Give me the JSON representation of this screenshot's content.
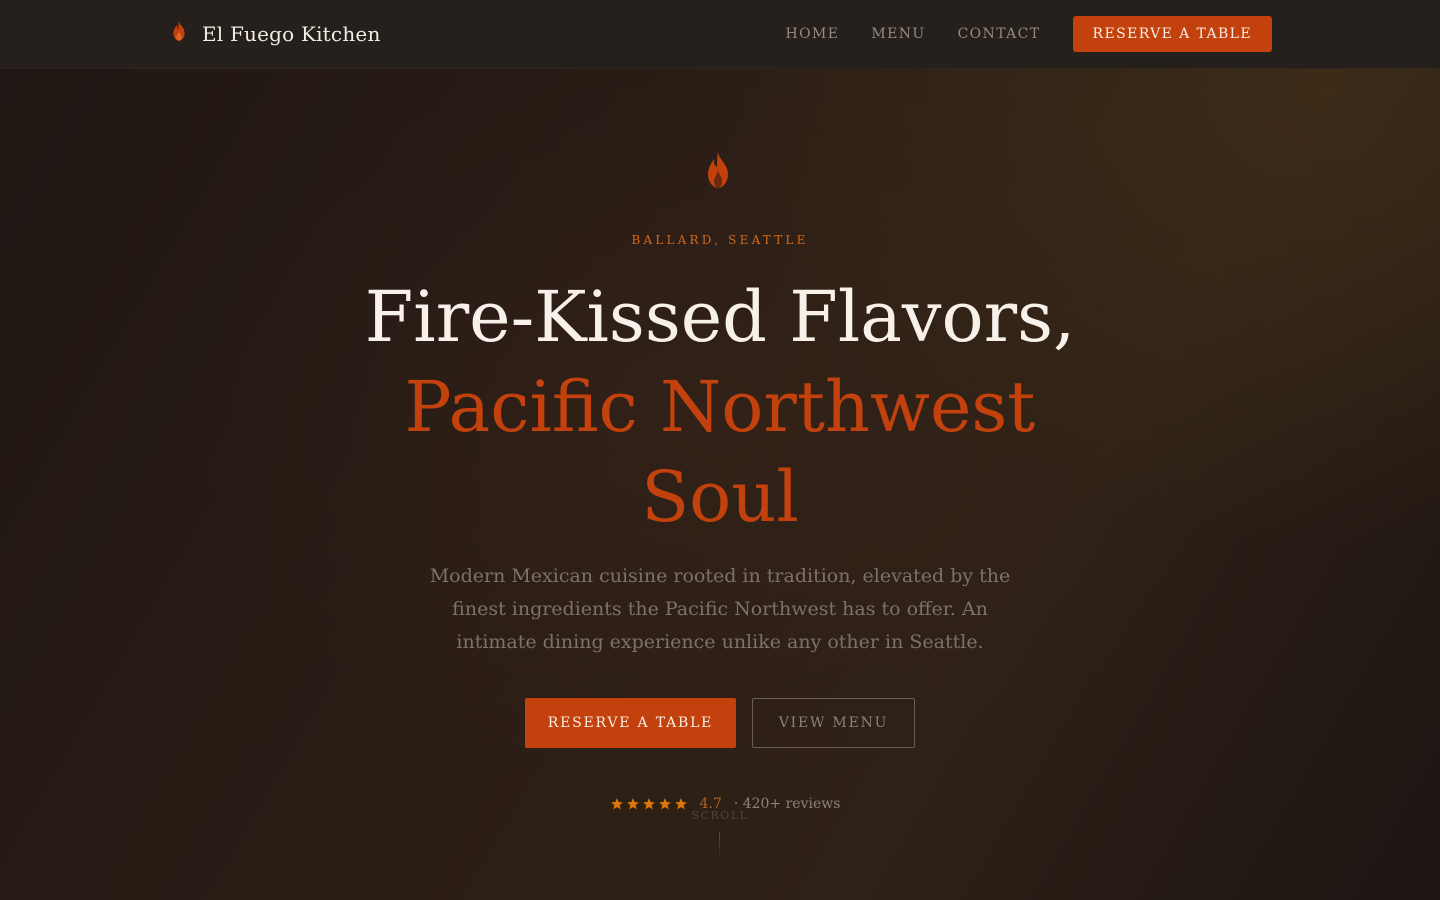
{
  "brand": {
    "name": "El Fuego Kitchen",
    "icon": "flame-icon"
  },
  "nav": {
    "links": [
      "HOME",
      "MENU",
      "CONTACT"
    ],
    "cta_label": "RESERVE A TABLE"
  },
  "hero": {
    "icon": "flame-icon",
    "location": "BALLARD, SEATTLE",
    "headline_line1": "Fire-Kissed Flavors,",
    "headline_line2": "Pacific Northwest",
    "headline_line3": "Soul",
    "tagline": "Modern Mexican cuisine rooted in tradition, elevated by the finest ingredients the Pacific Northwest has to offer. An intimate dining experience unlike any other in Seattle.",
    "primary_button": "RESERVE A TABLE",
    "secondary_button": "VIEW MENU",
    "rating": {
      "stars": 5,
      "score": "4.7",
      "count_text": "· 420+ reviews"
    },
    "scroll_label": "SCROLL"
  },
  "colors": {
    "accent": "#c2410c",
    "gold": "#d97706",
    "background": "#231813",
    "nav_background": "#26201d"
  }
}
